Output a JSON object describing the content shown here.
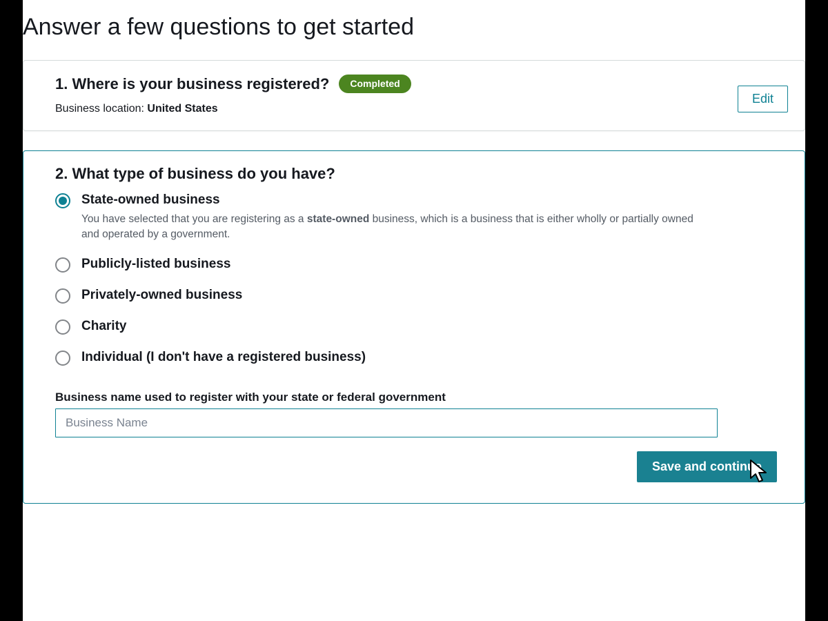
{
  "page_title": "Answer a few questions to get started",
  "question1": {
    "title": "1. Where is your business registered?",
    "status_label": "Completed",
    "summary_prefix": "Business location: ",
    "summary_value": "United States",
    "edit_label": "Edit"
  },
  "question2": {
    "title": "2. What type of business do you have?",
    "options": [
      {
        "label": "State-owned business",
        "selected": true,
        "description_prefix": "You have selected that you are registering as a ",
        "description_bold": "state-owned",
        "description_suffix": " business, which is a business that is either wholly or partially owned and operated by a government."
      },
      {
        "label": "Publicly-listed business",
        "selected": false
      },
      {
        "label": "Privately-owned business",
        "selected": false
      },
      {
        "label": "Charity",
        "selected": false
      },
      {
        "label": "Individual (I don't have a registered business)",
        "selected": false
      }
    ],
    "business_name_label": "Business name used to register with your state or federal government",
    "business_name_placeholder": "Business Name",
    "save_button_label": "Save and continue"
  }
}
